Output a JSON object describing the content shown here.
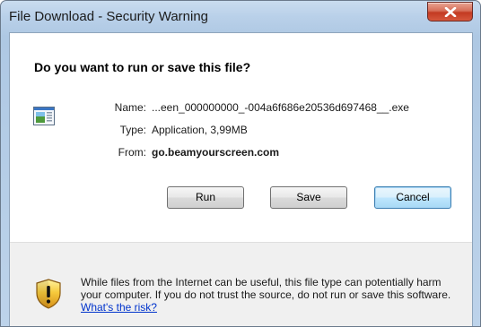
{
  "window": {
    "title": "File Download - Security Warning"
  },
  "dialog": {
    "heading": "Do you want to run or save this file?",
    "fields": {
      "name_label": "Name:",
      "name_value": "...een_000000000_-004a6f686e20536d697468__.exe",
      "type_label": "Type:",
      "type_value": "Application, 3,99MB",
      "from_label": "From:",
      "from_value": "go.beamyourscreen.com"
    },
    "buttons": {
      "run": "Run",
      "save": "Save",
      "cancel": "Cancel"
    }
  },
  "footer": {
    "warning": "While files from the Internet can be useful, this file type can potentially harm your computer. If you do not trust the source, do not run or save this software.",
    "link": "What's the risk?"
  },
  "colors": {
    "titlebar": "#b9d0e9",
    "close_button": "#c33a22",
    "link": "#0033cc",
    "footer_bg": "#f0f0f0"
  },
  "icons": {
    "file": "application-file-icon",
    "warning": "security-shield-icon",
    "close": "close-icon"
  }
}
